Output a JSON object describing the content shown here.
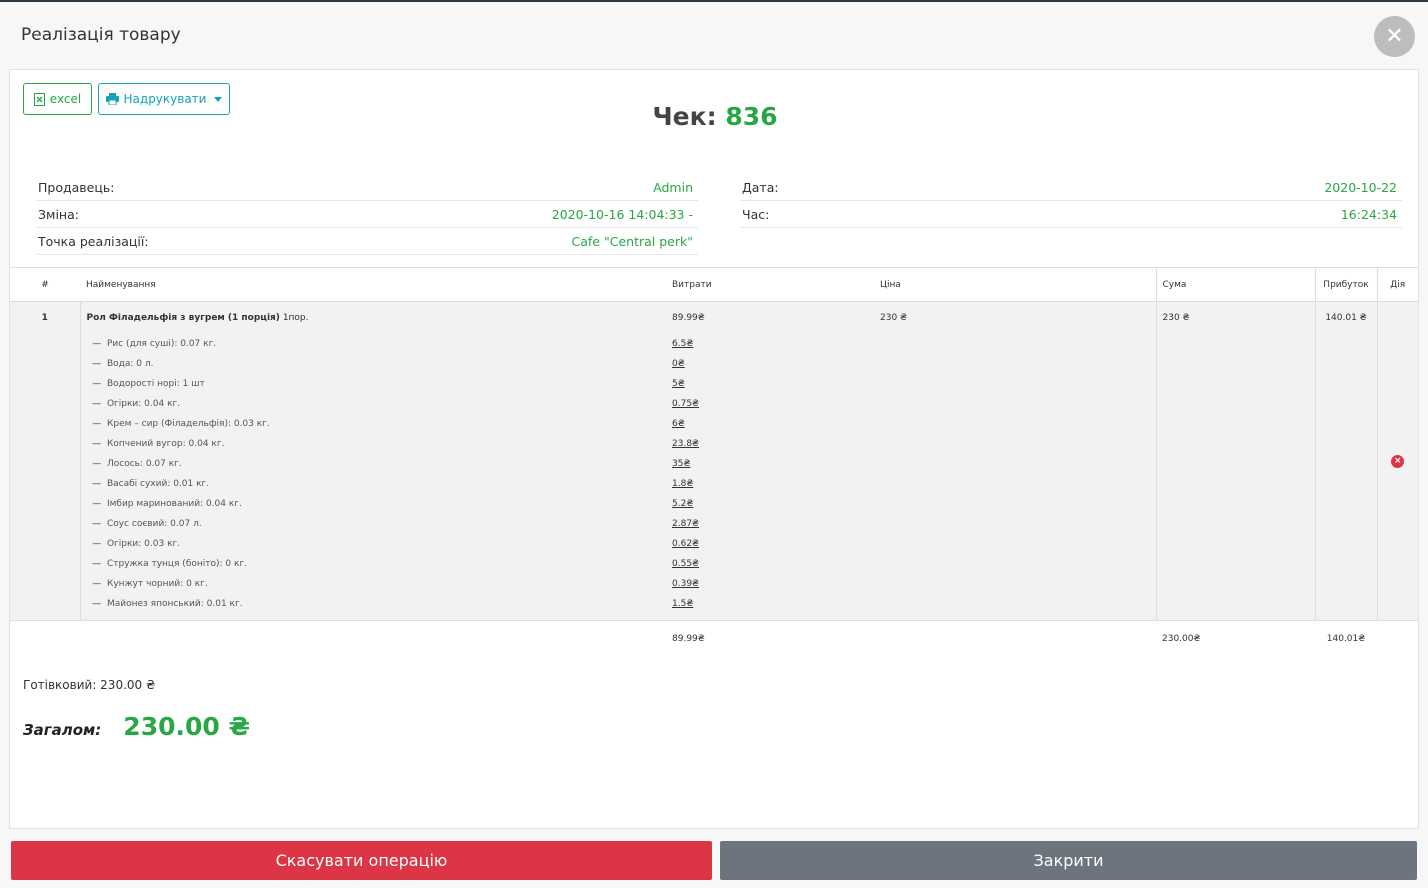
{
  "modal": {
    "title": "Реалізація товару",
    "close_symbol": "✕"
  },
  "toolbar": {
    "excel_label": "excel",
    "print_label": "Надрукувати",
    "excel_icon": "excel-file-icon",
    "print_icon": "printer-icon"
  },
  "check": {
    "label": "Чек:",
    "number": "836"
  },
  "info_left": [
    {
      "label": "Продавець:",
      "value": "Admin"
    },
    {
      "label": "Зміна:",
      "value": "2020-10-16 14:04:33 -"
    },
    {
      "label": "Точка реалізації:",
      "value": "Cafe \"Central perk\""
    }
  ],
  "info_right": [
    {
      "label": "Дата:",
      "value": "2020-10-22"
    },
    {
      "label": "Час:",
      "value": "16:24:34"
    }
  ],
  "table": {
    "headers": {
      "num": "#",
      "name": "Найменування",
      "cost": "Витрати",
      "price": "Ціна",
      "sum": "Сума",
      "profit": "Прибуток",
      "action": "Дія"
    },
    "item": {
      "num": "1",
      "name": "Рол Філадельфія з вугрем (1 порція)",
      "qty": "1пор.",
      "cost": "89.99₴",
      "price": "230 ₴",
      "sum": "230 ₴",
      "profit": "140.01 ₴",
      "dash": "—",
      "ingredients": [
        {
          "name": "Рис (для суші): 0.07 кг.",
          "cost": "6.5₴"
        },
        {
          "name": "Вода: 0 л.",
          "cost": "0₴"
        },
        {
          "name": "Водорості норі: 1 шт",
          "cost": "5₴"
        },
        {
          "name": "Огірки: 0.04 кг.",
          "cost": "0.75₴"
        },
        {
          "name": "Крем – сир (Філадельфія): 0.03 кг.",
          "cost": "6₴"
        },
        {
          "name": "Копчений вугор: 0.04 кг.",
          "cost": "23.8₴"
        },
        {
          "name": "Лосось: 0.07 кг.",
          "cost": "35₴"
        },
        {
          "name": "Васабі сухий: 0.01 кг.",
          "cost": "1.8₴"
        },
        {
          "name": "Імбир маринований: 0.04 кг.",
          "cost": "5.2₴"
        },
        {
          "name": "Соус соєвий: 0.07 л.",
          "cost": "2.87₴"
        },
        {
          "name": "Огірки: 0.03 кг.",
          "cost": "0.62₴"
        },
        {
          "name": "Стружка тунця (боніто): 0 кг.",
          "cost": "0.55₴"
        },
        {
          "name": "Кунжут чорний: 0 кг.",
          "cost": "0.39₴"
        },
        {
          "name": "Майонез японський: 0.01 кг.",
          "cost": "1.5₴"
        }
      ]
    },
    "totals": {
      "cost": "89.99₴",
      "sum": "230.00₴",
      "profit": "140.01₴"
    }
  },
  "payment": {
    "cash": "Готівковий: 230.00 ₴"
  },
  "total": {
    "label": "Загалом:",
    "value": "230.00 ₴"
  },
  "footer": {
    "cancel_label": "Скасувати операцію",
    "close_label": "Закрити"
  },
  "colors": {
    "accent": "#28a745",
    "danger": "#dc3545",
    "info": "#17a2b8",
    "secondary": "#6c757d"
  }
}
